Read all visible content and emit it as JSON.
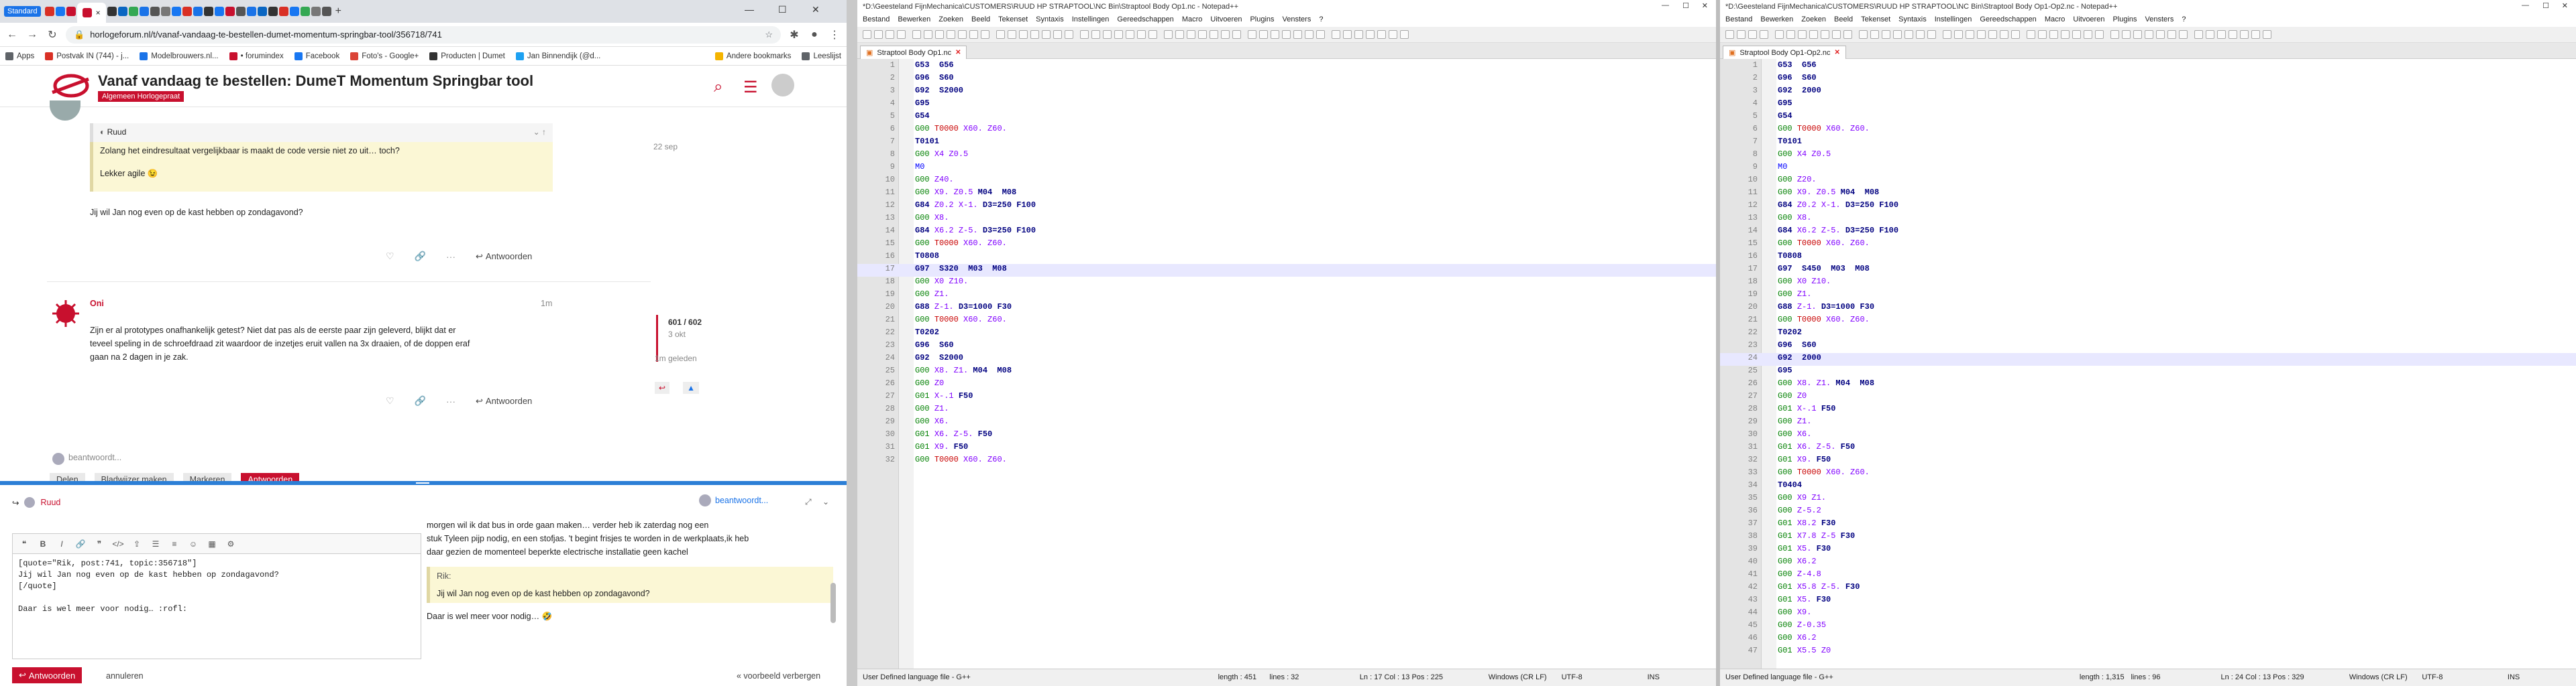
{
  "browser": {
    "profile": "Standard",
    "active_tab_close": "×",
    "url": "horlogeforum.nl/t/vanaf-vandaag-te-bestellen-dumet-momentum-springbar-tool/356718/741",
    "bookmarks": [
      {
        "label": "Apps",
        "color": "#5f6368"
      },
      {
        "label": "Postvak IN (744) - j...",
        "color": "#d93025"
      },
      {
        "label": "Modelbrouwers.nl...",
        "color": "#1a73e8"
      },
      {
        "label": "• forumindex",
        "color": "#c8102e"
      },
      {
        "label": "Facebook",
        "color": "#1877f2"
      },
      {
        "label": "Foto's - Google+",
        "color": "#db4437"
      },
      {
        "label": "Producten | Dumet",
        "color": "#333333"
      },
      {
        "label": "Jan Binnendijk (@d...",
        "color": "#1da1f2"
      },
      {
        "label": "Andere bookmarks",
        "color": "#f4b400"
      },
      {
        "label": "Leeslijst",
        "color": "#5f6368"
      }
    ]
  },
  "forum": {
    "title": "Vanaf vandaag te bestellen: DumeT Momentum Springbar tool",
    "category": "Algemeen Horlogepraat",
    "post1": {
      "quote_author": "Ruud",
      "quote_line1": "Zolang het eindresultaat vergelijkbaar is maakt de code versie niet zo uit… toch?",
      "quote_line2": "Lekker agile 😉",
      "date": "22 sep",
      "text": "Jij wil Jan nog even op de kast hebben op zondagavond?",
      "reply": "Antwoorden"
    },
    "post2": {
      "author": "Oni",
      "time": "1m",
      "text1": "Zijn er al prototypes onafhankelijk getest? Niet dat pas als de eerste paar zijn geleverd, blijkt dat er",
      "text2": "teveel speling in de schroefdraad zit waardoor de inzetjes eruit vallen na 3x draaien, of de doppen eraf",
      "text3": "gaan na 2 dagen in je zak.",
      "reply": "Antwoorden"
    },
    "timeline": {
      "position": "601 / 602",
      "date": "3 okt",
      "ago": "1m geleden"
    },
    "typing": "beantwoordt...",
    "bottom_actions": [
      "Delen",
      "Bladwijzer maken",
      "Markeren",
      "Antwoorden"
    ]
  },
  "composer": {
    "reply_to": "Ruud",
    "typing_user": "beantwoordt...",
    "editor_lines": [
      "[quote=\"Rik, post:741, topic:356718\"]",
      "Jij wil Jan nog even op de kast hebben op zondagavond?",
      "[/quote]",
      "",
      "Daar is wel meer voor nodig… :rofl:"
    ],
    "preview_line1": "morgen wil ik dat bus in orde gaan maken… verder heb ik zaterdag nog een",
    "preview_line2": "stuk Tyleen pijp nodig, en een stofjas. 't begint frisjes te worden in de werkplaats,ik heb",
    "preview_line3": "daar gezien de momenteel beperkte electrische installatie geen kachel",
    "preview_quote_author": "Rik:",
    "preview_quote": "Jij wil Jan nog even op de kast hebben op zondagavond?",
    "preview_text": "Daar is wel meer voor nodig… 🤣",
    "send": "Antwoorden",
    "cancel": "annuleren",
    "toggle_preview": "« voorbeeld verbergen"
  },
  "npp_left": {
    "title": "*D:\\Geesteland FijnMechanica\\CUSTOMERS\\RUUD HP STRAPTOOL\\NC Bin\\Straptool Body Op1.nc - Notepad++",
    "menu": [
      "Bestand",
      "Bewerken",
      "Zoeken",
      "Beeld",
      "Tekenset",
      "Syntaxis",
      "Instellingen",
      "Gereedschappen",
      "Macro",
      "Uitvoeren",
      "Plugins",
      "Vensters",
      "?"
    ],
    "tab": "Straptool Body Op1.nc",
    "status": {
      "lang": "User Defined language file - G++",
      "length": "length : 451",
      "lines": "lines : 32",
      "pos": "Ln : 17    Col : 13    Pos : 225",
      "eol": "Windows (CR LF)",
      "enc": "UTF-8",
      "ins": "INS"
    },
    "current_line": 17,
    "lines": [
      [
        [
          "ck",
          "G53  G56"
        ]
      ],
      [
        [
          "ck",
          "G96  S60"
        ]
      ],
      [
        [
          "ck",
          "G92  S2000"
        ]
      ],
      [
        [
          "ck",
          "G95"
        ]
      ],
      [
        [
          "ck",
          "G54"
        ]
      ],
      [
        [
          "cg",
          "G00 "
        ],
        [
          "cr",
          "T0000 "
        ],
        [
          "cm",
          "X60. Z60."
        ]
      ],
      [
        [
          "ck",
          "T0101"
        ]
      ],
      [
        [
          "tx",
          "    "
        ],
        [
          "cg",
          "G00 "
        ],
        [
          "cm",
          "X4 Z0.5"
        ]
      ],
      [
        [
          "tx",
          "    "
        ],
        [
          "cb",
          "M0"
        ]
      ],
      [
        [
          "tx",
          "    "
        ],
        [
          "cg",
          "G00 "
        ],
        [
          "cm",
          "Z40."
        ]
      ],
      [
        [
          "tx",
          "    "
        ],
        [
          "cg",
          "G00 "
        ],
        [
          "cm",
          "X9. Z0.5 "
        ],
        [
          "ck",
          "M04  M08"
        ]
      ],
      [
        [
          "tx",
          "    "
        ],
        [
          "ck",
          "G84 "
        ],
        [
          "cm",
          "Z0.2 X-1. "
        ],
        [
          "ck",
          "D3=250 F100"
        ]
      ],
      [
        [
          "tx",
          "    "
        ],
        [
          "cg",
          "G00 "
        ],
        [
          "cm",
          "X8."
        ]
      ],
      [
        [
          "tx",
          "    "
        ],
        [
          "ck",
          "G84 "
        ],
        [
          "cm",
          "X6.2 Z-5. "
        ],
        [
          "ck",
          "D3=250 F100"
        ]
      ],
      [
        [
          "tx",
          "    "
        ],
        [
          "cg",
          "G00 "
        ],
        [
          "cr",
          "T0000 "
        ],
        [
          "cm",
          "X60. Z60."
        ]
      ],
      [
        [
          "ck",
          "T0808"
        ]
      ],
      [
        [
          "tx",
          "    "
        ],
        [
          "ck",
          "G97  S320  M03  M08"
        ]
      ],
      [
        [
          "tx",
          "    "
        ],
        [
          "cg",
          "G00 "
        ],
        [
          "cm",
          "X0 Z10."
        ]
      ],
      [
        [
          "tx",
          "    "
        ],
        [
          "cg",
          "G00 "
        ],
        [
          "cm",
          "Z1."
        ]
      ],
      [
        [
          "tx",
          "    "
        ],
        [
          "ck",
          "G88 "
        ],
        [
          "cm",
          "Z-1. "
        ],
        [
          "ck",
          "D3=1000 F30"
        ]
      ],
      [
        [
          "tx",
          "    "
        ],
        [
          "cg",
          "G00 "
        ],
        [
          "cr",
          "T0000 "
        ],
        [
          "cm",
          "X60. Z60."
        ]
      ],
      [
        [
          "ck",
          "T0202"
        ]
      ],
      [
        [
          "tx",
          "    "
        ],
        [
          "ck",
          "G96  S60"
        ]
      ],
      [
        [
          "tx",
          "    "
        ],
        [
          "ck",
          "G92  S2000"
        ]
      ],
      [
        [
          "tx",
          "    "
        ],
        [
          "cg",
          "G00 "
        ],
        [
          "cm",
          "X8. Z1. "
        ],
        [
          "ck",
          "M04  M08"
        ]
      ],
      [
        [
          "tx",
          "    "
        ],
        [
          "cg",
          "G00 "
        ],
        [
          "cm",
          "Z0"
        ]
      ],
      [
        [
          "tx",
          "    "
        ],
        [
          "cg",
          "G01 "
        ],
        [
          "cm",
          "X-.1 "
        ],
        [
          "ck",
          "F50"
        ]
      ],
      [
        [
          "tx",
          "    "
        ],
        [
          "cg",
          "G00 "
        ],
        [
          "cm",
          "Z1."
        ]
      ],
      [
        [
          "tx",
          "    "
        ],
        [
          "cg",
          "G00 "
        ],
        [
          "cm",
          "X6."
        ]
      ],
      [
        [
          "tx",
          "    "
        ],
        [
          "cg",
          "G01 "
        ],
        [
          "cm",
          "X6. Z-5. "
        ],
        [
          "ck",
          "F50"
        ]
      ],
      [
        [
          "tx",
          "    "
        ],
        [
          "cg",
          "G01 "
        ],
        [
          "cm",
          "X9. "
        ],
        [
          "ck",
          "F50"
        ]
      ],
      [
        [
          "tx",
          "    "
        ],
        [
          "cg",
          "G00 "
        ],
        [
          "cr",
          "T0000 "
        ],
        [
          "cm",
          "X60. Z60."
        ]
      ]
    ]
  },
  "npp_right": {
    "title": "*D:\\Geesteland FijnMechanica\\CUSTOMERS\\RUUD HP STRAPTOOL\\NC Bin\\Straptool Body Op1-Op2.nc - Notepad++",
    "menu": [
      "Bestand",
      "Bewerken",
      "Zoeken",
      "Beeld",
      "Tekenset",
      "Syntaxis",
      "Instellingen",
      "Gereedschappen",
      "Macro",
      "Uitvoeren",
      "Plugins",
      "Vensters",
      "?"
    ],
    "tab": "Straptool Body Op1-Op2.nc",
    "status": {
      "lang": "User Defined language file - G++",
      "length": "length : 1,315",
      "lines": "lines : 96",
      "pos": "Ln : 24    Col : 13    Pos : 329",
      "eol": "Windows (CR LF)",
      "enc": "UTF-8",
      "ins": "INS"
    },
    "current_line": 24,
    "lines": [
      [
        [
          "ck",
          "G53  G56"
        ]
      ],
      [
        [
          "ck",
          "G96  S60"
        ]
      ],
      [
        [
          "ck",
          "G92  2000"
        ]
      ],
      [
        [
          "ck",
          "G95"
        ]
      ],
      [
        [
          "ck",
          "G54"
        ]
      ],
      [
        [
          "cg",
          "G00 "
        ],
        [
          "cr",
          "T0000 "
        ],
        [
          "cm",
          "X60. Z60."
        ]
      ],
      [
        [
          "ck",
          "T0101"
        ]
      ],
      [
        [
          "tx",
          "    "
        ],
        [
          "cg",
          "G00 "
        ],
        [
          "cm",
          "X4 Z0.5"
        ]
      ],
      [
        [
          "tx",
          "    "
        ],
        [
          "cb",
          "M0"
        ]
      ],
      [
        [
          "tx",
          "    "
        ],
        [
          "cg",
          "G00 "
        ],
        [
          "cm",
          "Z20."
        ]
      ],
      [
        [
          "tx",
          "    "
        ],
        [
          "cg",
          "G00 "
        ],
        [
          "cm",
          "X9. Z0.5 "
        ],
        [
          "ck",
          "M04  M08"
        ]
      ],
      [
        [
          "tx",
          "    "
        ],
        [
          "ck",
          "G84 "
        ],
        [
          "cm",
          "Z0.2 X-1. "
        ],
        [
          "ck",
          "D3=250 F100"
        ]
      ],
      [
        [
          "tx",
          "    "
        ],
        [
          "cg",
          "G00 "
        ],
        [
          "cm",
          "X8."
        ]
      ],
      [
        [
          "tx",
          "    "
        ],
        [
          "ck",
          "G84 "
        ],
        [
          "cm",
          "X6.2 Z-5. "
        ],
        [
          "ck",
          "D3=250 F100"
        ]
      ],
      [
        [
          "tx",
          "    "
        ],
        [
          "cg",
          "G00 "
        ],
        [
          "cr",
          "T0000 "
        ],
        [
          "cm",
          "X60. Z60."
        ]
      ],
      [
        [
          "ck",
          "T0808"
        ]
      ],
      [
        [
          "tx",
          "    "
        ],
        [
          "ck",
          "G97  S450  M03  M08"
        ]
      ],
      [
        [
          "tx",
          "    "
        ],
        [
          "cg",
          "G00 "
        ],
        [
          "cm",
          "X0 Z10."
        ]
      ],
      [
        [
          "tx",
          "    "
        ],
        [
          "cg",
          "G00 "
        ],
        [
          "cm",
          "Z1."
        ]
      ],
      [
        [
          "tx",
          "    "
        ],
        [
          "ck",
          "G88 "
        ],
        [
          "cm",
          "Z-1. "
        ],
        [
          "ck",
          "D3=1000 F30"
        ]
      ],
      [
        [
          "tx",
          "    "
        ],
        [
          "cg",
          "G00 "
        ],
        [
          "cr",
          "T0000 "
        ],
        [
          "cm",
          "X60. Z60."
        ]
      ],
      [
        [
          "ck",
          "T0202"
        ]
      ],
      [
        [
          "tx",
          "    "
        ],
        [
          "ck",
          "G96  S60"
        ]
      ],
      [
        [
          "tx",
          "    "
        ],
        [
          "ck",
          "G92  2000"
        ]
      ],
      [
        [
          "tx",
          "    "
        ],
        [
          "ck",
          "G95"
        ]
      ],
      [
        [
          "tx",
          "    "
        ],
        [
          "cg",
          "G00 "
        ],
        [
          "cm",
          "X8. Z1. "
        ],
        [
          "ck",
          "M04  M08"
        ]
      ],
      [
        [
          "tx",
          "    "
        ],
        [
          "cg",
          "G00 "
        ],
        [
          "cm",
          "Z0"
        ]
      ],
      [
        [
          "tx",
          "    "
        ],
        [
          "cg",
          "G01 "
        ],
        [
          "cm",
          "X-.1 "
        ],
        [
          "ck",
          "F50"
        ]
      ],
      [
        [
          "tx",
          "    "
        ],
        [
          "cg",
          "G00 "
        ],
        [
          "cm",
          "Z1."
        ]
      ],
      [
        [
          "tx",
          "    "
        ],
        [
          "cg",
          "G00 "
        ],
        [
          "cm",
          "X6."
        ]
      ],
      [
        [
          "tx",
          "    "
        ],
        [
          "cg",
          "G01 "
        ],
        [
          "cm",
          "X6. Z-5. "
        ],
        [
          "ck",
          "F50"
        ]
      ],
      [
        [
          "tx",
          "    "
        ],
        [
          "cg",
          "G01 "
        ],
        [
          "cm",
          "X9. "
        ],
        [
          "ck",
          "F50"
        ]
      ],
      [
        [
          "tx",
          "    "
        ],
        [
          "cg",
          "G00 "
        ],
        [
          "cr",
          "T0000 "
        ],
        [
          "cm",
          "X60. Z60."
        ]
      ],
      [
        [
          "ck",
          "T0404"
        ]
      ],
      [
        [
          "tx",
          "    "
        ],
        [
          "cg",
          "G00 "
        ],
        [
          "cm",
          "X9 Z1."
        ]
      ],
      [
        [
          "tx",
          "    "
        ],
        [
          "cg",
          "G00 "
        ],
        [
          "cm",
          "Z-5.2"
        ]
      ],
      [
        [
          "tx",
          "    "
        ],
        [
          "cg",
          "G01 "
        ],
        [
          "cm",
          "X8.2 "
        ],
        [
          "ck",
          "F30"
        ]
      ],
      [
        [
          "tx",
          "    "
        ],
        [
          "cg",
          "G01 "
        ],
        [
          "cm",
          "X7.8 Z-5 "
        ],
        [
          "ck",
          "F30"
        ]
      ],
      [
        [
          "tx",
          "    "
        ],
        [
          "cg",
          "G01 "
        ],
        [
          "cm",
          "X5. "
        ],
        [
          "ck",
          "F30"
        ]
      ],
      [
        [
          "tx",
          "    "
        ],
        [
          "cg",
          "G00 "
        ],
        [
          "cm",
          "X6.2"
        ]
      ],
      [
        [
          "tx",
          "    "
        ],
        [
          "cg",
          "G00 "
        ],
        [
          "cm",
          "Z-4.8"
        ]
      ],
      [
        [
          "tx",
          "    "
        ],
        [
          "cg",
          "G01 "
        ],
        [
          "cm",
          "X5.8 Z-5. "
        ],
        [
          "ck",
          "F30"
        ]
      ],
      [
        [
          "tx",
          "    "
        ],
        [
          "cg",
          "G01 "
        ],
        [
          "cm",
          "X5. "
        ],
        [
          "ck",
          "F30"
        ]
      ],
      [
        [
          "tx",
          "    "
        ],
        [
          "cg",
          "G00 "
        ],
        [
          "cm",
          "X9."
        ]
      ],
      [
        [
          "tx",
          "    "
        ],
        [
          "cg",
          "G00 "
        ],
        [
          "cm",
          "Z-0.35"
        ]
      ],
      [
        [
          "tx",
          "    "
        ],
        [
          "cg",
          "G00 "
        ],
        [
          "cm",
          "X6.2"
        ]
      ],
      [
        [
          "tx",
          "    "
        ],
        [
          "cg",
          "G01 "
        ],
        [
          "cm",
          "X5.5 Z0"
        ]
      ]
    ]
  }
}
